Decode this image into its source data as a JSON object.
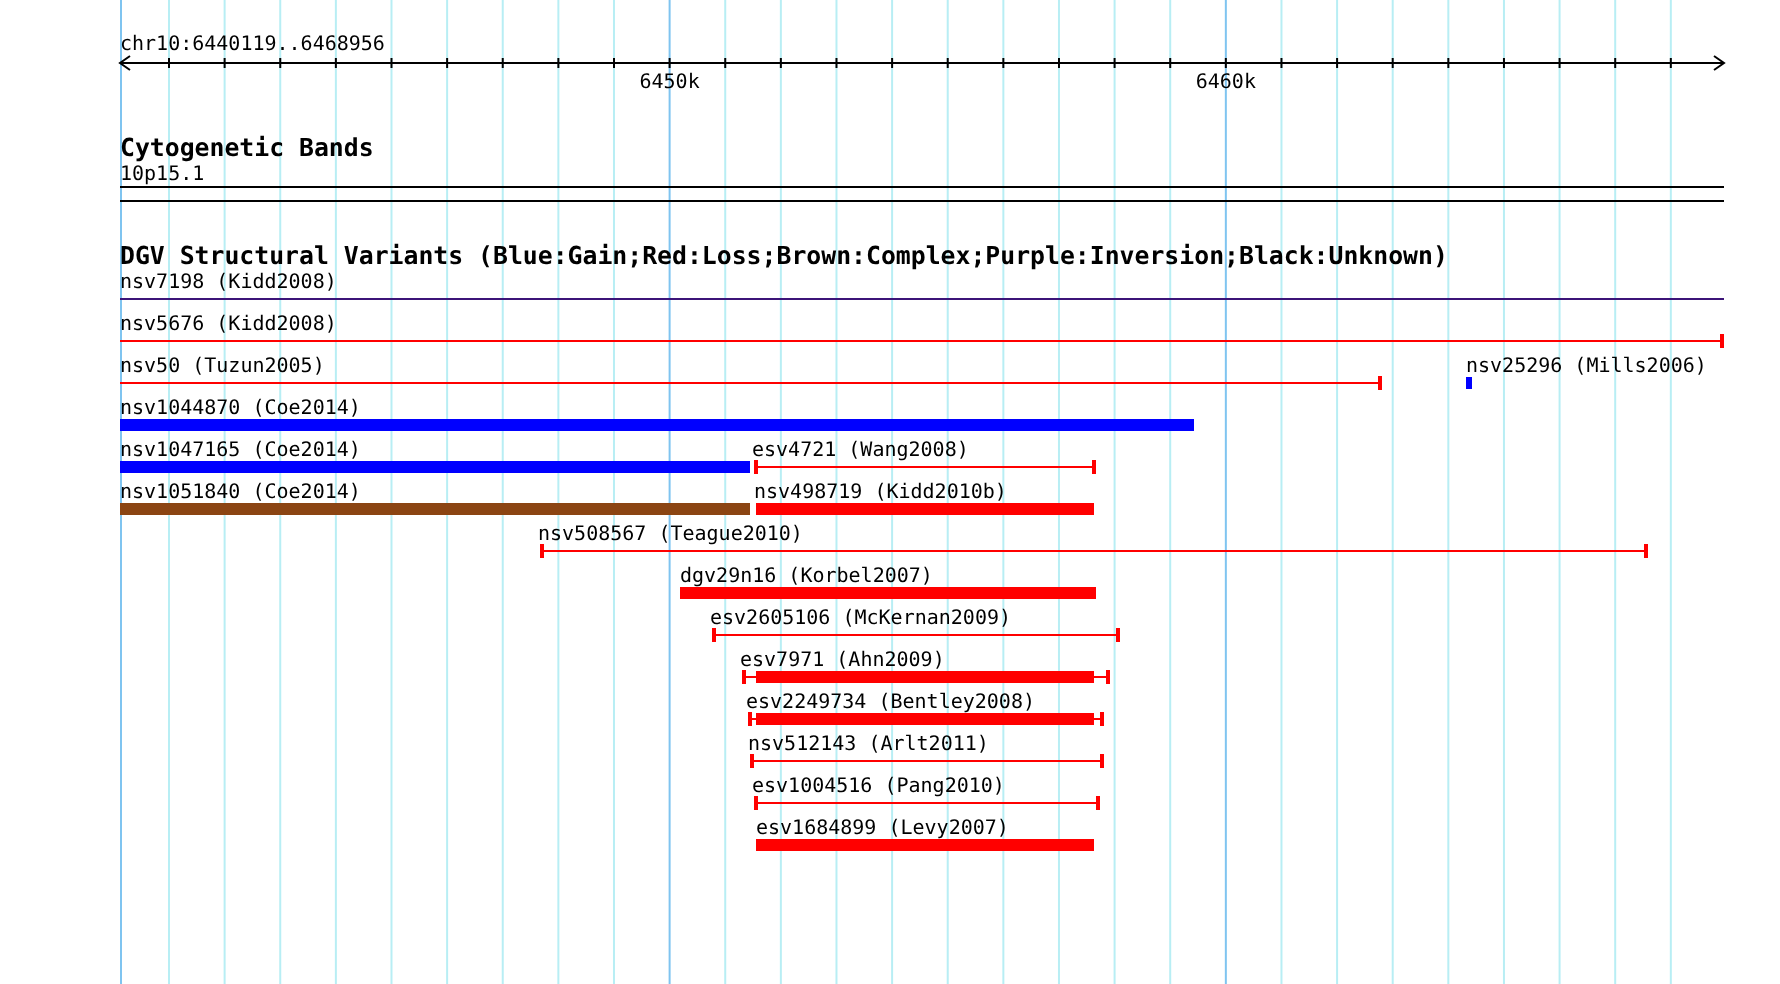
{
  "ruler": {
    "range": "chr10:6440119..6468956",
    "ticks": [
      "6450k",
      "6460k"
    ]
  },
  "cytoband_track": {
    "title": "Cytogenetic Bands",
    "band": "10p15.1"
  },
  "variant_track": {
    "title": "DGV Structural Variants (Blue:Gain;Red:Loss;Brown:Complex;Purple:Inversion;Black:Unknown)",
    "variants": [
      {
        "label": "nsv7198 (Kidd2008)",
        "kind": "line",
        "color": "#3c1478"
      },
      {
        "label": "nsv5676 (Kidd2008)",
        "kind": "line",
        "color": "#ff0000"
      },
      {
        "label": "nsv50 (Tuzun2005)",
        "kind": "line",
        "color": "#ff0000"
      },
      {
        "label": "nsv25296 (Mills2006)",
        "kind": "bar",
        "color": "#0000ff"
      },
      {
        "label": "nsv1044870 (Coe2014)",
        "kind": "bar",
        "color": "#0000ff"
      },
      {
        "label": "nsv1047165 (Coe2014)",
        "kind": "bar",
        "color": "#0000ff"
      },
      {
        "label": "esv4721 (Wang2008)",
        "kind": "line",
        "color": "#ff0000"
      },
      {
        "label": "nsv1051840 (Coe2014)",
        "kind": "bar",
        "color": "#8b4513"
      },
      {
        "label": "nsv498719 (Kidd2010b)",
        "kind": "bar",
        "color": "#ff0000"
      },
      {
        "label": "nsv508567 (Teague2010)",
        "kind": "line",
        "color": "#ff0000"
      },
      {
        "label": "dgv29n16 (Korbel2007)",
        "kind": "bar",
        "color": "#ff0000"
      },
      {
        "label": "esv2605106 (McKernan2009)",
        "kind": "line",
        "color": "#ff0000"
      },
      {
        "label": "esv7971 (Ahn2009)",
        "kind": "capped-bar",
        "color": "#ff0000"
      },
      {
        "label": "esv2249734 (Bentley2008)",
        "kind": "capped-bar",
        "color": "#ff0000"
      },
      {
        "label": "nsv512143 (Arlt2011)",
        "kind": "line",
        "color": "#ff0000"
      },
      {
        "label": "esv1004516 (Pang2010)",
        "kind": "line",
        "color": "#ff0000"
      },
      {
        "label": "esv1684899 (Levy2007)",
        "kind": "bar",
        "color": "#ff0000"
      }
    ]
  }
}
